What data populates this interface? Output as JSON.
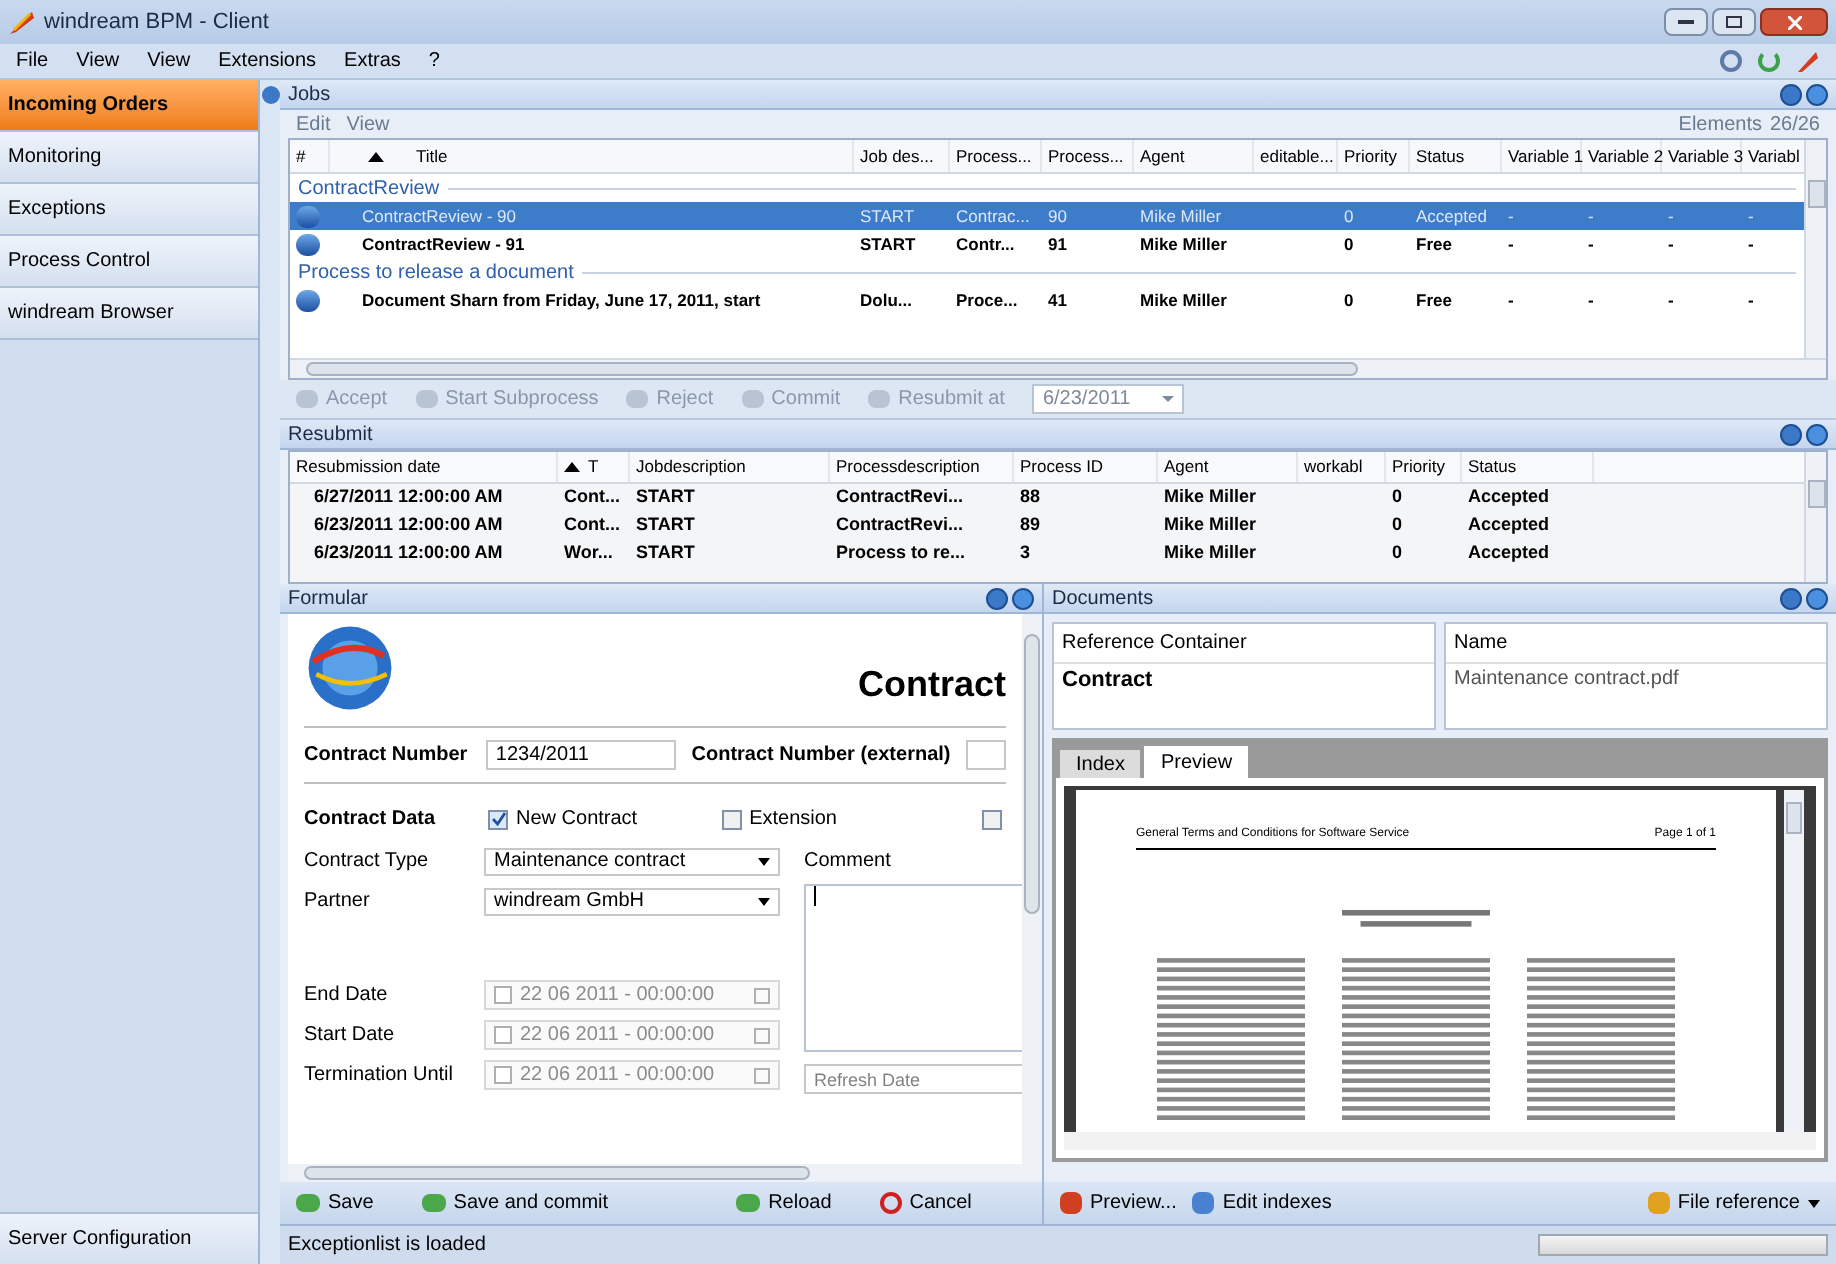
{
  "window": {
    "title": "windream BPM - Client"
  },
  "menu": [
    "File",
    "View",
    "View",
    "Extensions",
    "Extras",
    "?"
  ],
  "sidebar": {
    "items": [
      {
        "label": "Incoming Orders",
        "selected": true
      },
      {
        "label": "Monitoring",
        "selected": false
      },
      {
        "label": "Exceptions",
        "selected": false
      },
      {
        "label": "Process Control",
        "selected": false
      },
      {
        "label": "windream Browser",
        "selected": false
      }
    ],
    "bottom_item": "Server Configuration"
  },
  "jobs": {
    "title": "Jobs",
    "menu": [
      "Edit",
      "View"
    ],
    "elements_label": "Elements",
    "elements_count": "26/26",
    "columns": [
      "#",
      "Title",
      "Job des...",
      "Process...",
      "Process...",
      "Agent",
      "editable...",
      "Priority",
      "Status",
      "Variable 1",
      "Variable 2",
      "Variable 3",
      "Variabl"
    ],
    "rows": [
      {
        "kind": "group",
        "label": "ContractReview"
      },
      {
        "kind": "job",
        "selected": true,
        "cells": [
          "",
          "ContractReview - 90",
          "START",
          "Contrac...",
          "90",
          "Mike Miller",
          "",
          "0",
          "Accepted",
          "-",
          "-",
          "-",
          "-"
        ]
      },
      {
        "kind": "job",
        "selected": false,
        "cells": [
          "",
          "ContractReview - 91",
          "START",
          "Contr...",
          "91",
          "Mike Miller",
          "",
          "0",
          "Free",
          "-",
          "-",
          "-",
          "-"
        ]
      },
      {
        "kind": "group",
        "label": "Process to release a document"
      },
      {
        "kind": "job",
        "selected": false,
        "cells": [
          "",
          "Document Sharn from Friday, June 17, 2011, start",
          "Dolu...",
          "Proce...",
          "41",
          "Mike Miller",
          "",
          "0",
          "Free",
          "-",
          "-",
          "-",
          "-"
        ]
      }
    ]
  },
  "toolbar": {
    "buttons": [
      {
        "label": "Accept",
        "disabled": true
      },
      {
        "label": "Start Subprocess",
        "disabled": true
      },
      {
        "label": "Reject",
        "disabled": true
      },
      {
        "label": "Commit",
        "disabled": true
      },
      {
        "label": "Resubmit at",
        "disabled": true
      }
    ],
    "date": "6/23/2011"
  },
  "resubmit": {
    "title": "Resubmit",
    "columns": [
      "Resubmission date",
      "T",
      "Jobdescription",
      "Processdescription",
      "Process ID",
      "Agent",
      "workabl",
      "Priority",
      "Status"
    ],
    "rows": [
      [
        "6/27/2011 12:00:00 AM",
        "Cont...",
        "START",
        "ContractRevi...",
        "88",
        "Mike Miller",
        "",
        "0",
        "Accepted"
      ],
      [
        "6/23/2011 12:00:00 AM",
        "Cont...",
        "START",
        "ContractRevi...",
        "89",
        "Mike Miller",
        "",
        "0",
        "Accepted"
      ],
      [
        "6/23/2011 12:00:00 AM",
        "Wor...",
        "START",
        "Process to re...",
        "3",
        "Mike Miller",
        "",
        "0",
        "Accepted"
      ]
    ]
  },
  "formular": {
    "title": "Formular",
    "heading": "Contract",
    "contract_number_label": "Contract Number",
    "contract_number": "1234/2011",
    "external_label": "Contract Number (external)",
    "contract_data_label": "Contract Data",
    "checkboxes": [
      {
        "label": "New Contract",
        "checked": true
      },
      {
        "label": "Extension",
        "checked": false
      },
      {
        "checked": false
      }
    ],
    "contract_type_label": "Contract Type",
    "contract_type": "Maintenance contract",
    "partner_label": "Partner",
    "partner": "windream GmbH",
    "comment_label": "Comment",
    "dates": [
      {
        "label": "End Date",
        "value": "22 06 2011 - 00:00:00",
        "checked": false
      },
      {
        "label": "Start Date",
        "value": "22 06 2011 - 00:00:00",
        "checked": false
      },
      {
        "label": "Termination Until",
        "value": "22 06 2011 - 00:00:00",
        "checked": false
      }
    ],
    "refresh_placeholder": "Refresh Date",
    "buttons": [
      "Save",
      "Save and commit",
      "Reload",
      "Cancel"
    ]
  },
  "documents": {
    "title": "Documents",
    "reference_label": "Reference Container",
    "reference": "Contract",
    "name_label": "Name",
    "name": "Maintenance contract.pdf",
    "tabs": [
      {
        "label": "Index",
        "selected": false
      },
      {
        "label": "Preview",
        "selected": true
      }
    ],
    "preview_header": "General Terms and Conditions for Software Service",
    "preview_page": "Page 1 of 1",
    "buttons": [
      "Preview...",
      "Edit indexes",
      "File reference"
    ]
  },
  "status_bar": {
    "text": "Exceptionlist is loaded",
    "progress": {
      "level": 0
    }
  }
}
